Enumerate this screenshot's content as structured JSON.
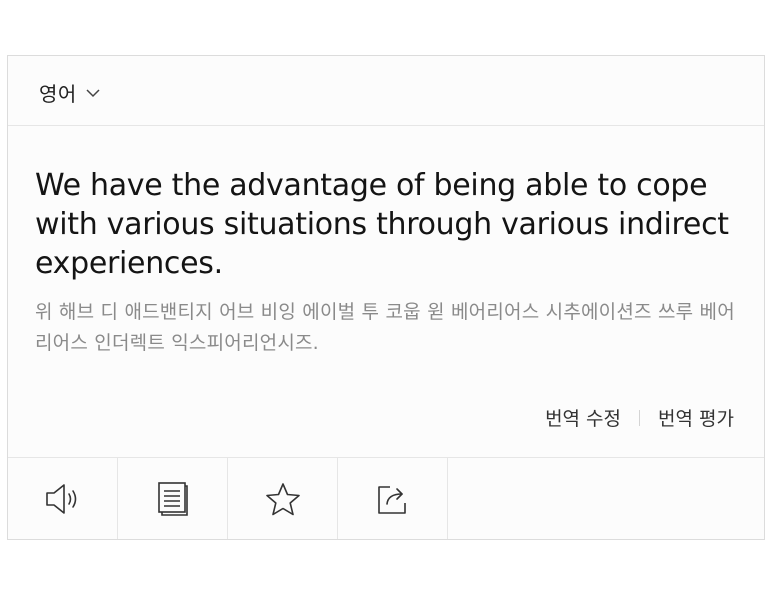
{
  "language": {
    "selected": "영어",
    "dropdown_icon": "chevron-down-icon"
  },
  "translation": {
    "text": "We have the advantage of being able to cope with various situations through various indirect experiences.",
    "pronunciation": "위 해브 디 애드밴티지 어브 비잉 에이벌 투 코웁 윋 베어리어스 시추에이션즈 쓰루 베어리어스 인더렉트 익스피어리언시즈."
  },
  "actions": {
    "edit_label": "번역 수정",
    "rate_label": "번역 평가"
  },
  "toolbar": {
    "icons": [
      "speaker-icon",
      "copy-icon",
      "star-icon",
      "share-icon"
    ]
  }
}
